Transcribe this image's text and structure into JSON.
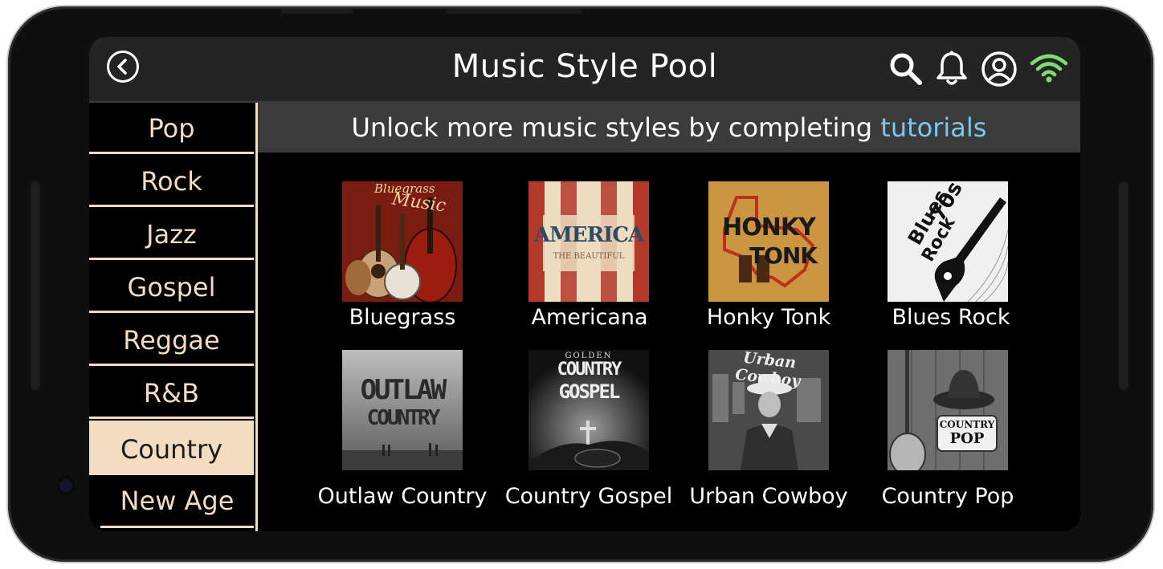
{
  "header": {
    "title": "Music Style Pool",
    "back_icon": "back-arrow-icon",
    "actions": [
      "search-icon",
      "bell-icon",
      "user-icon",
      "wifi-icon"
    ]
  },
  "sidebar": {
    "items": [
      {
        "label": "Pop"
      },
      {
        "label": "Rock"
      },
      {
        "label": "Jazz"
      },
      {
        "label": "Gospel"
      },
      {
        "label": "Reggae"
      },
      {
        "label": "R&B"
      },
      {
        "label": "Country"
      },
      {
        "label": "New Age"
      }
    ],
    "selected": "Country"
  },
  "banner": {
    "text": "Unlock more music styles by completing ",
    "link": "tutorials"
  },
  "styles": [
    {
      "label": "Bluegrass",
      "art": {
        "line1": "Bluegrass",
        "line2": "Music"
      }
    },
    {
      "label": "Americana",
      "art": {
        "line1": "AMERICA",
        "line2": "THE BEAUTIFUL"
      }
    },
    {
      "label": "Honky Tonk",
      "art": {
        "line1": "HONKY",
        "line2": "TONK"
      }
    },
    {
      "label": "Blues Rock",
      "art": {
        "line1": "70s",
        "line2": "Blues",
        "line3": "Rock"
      }
    },
    {
      "label": "Outlaw Country",
      "art": {
        "line1": "OUTLAW",
        "line2": "COUNTRY"
      }
    },
    {
      "label": "Country Gospel",
      "art": {
        "line1": "GOLDEN",
        "line2": "COUNTRY",
        "line3": "GOSPEL"
      }
    },
    {
      "label": "Urban Cowboy",
      "art": {
        "line1": "Urban Cowboy"
      }
    },
    {
      "label": "Country Pop",
      "art": {
        "line1": "COUNTRY",
        "line2": "POP"
      }
    }
  ],
  "colors": {
    "accent": "#f3dcc0",
    "link": "#7cc7ec",
    "wifi": "#7ddc74",
    "topbar": "#242424",
    "banner": "#3b3b3b"
  }
}
